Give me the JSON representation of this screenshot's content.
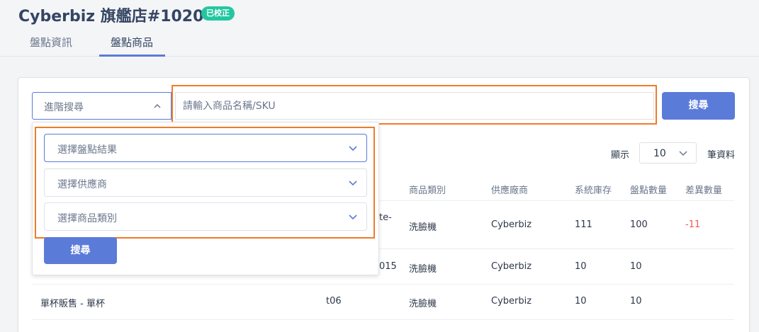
{
  "header": {
    "title": "Cyberbiz 旗艦店#1020",
    "badge": "已校正",
    "tabs": [
      {
        "label": "盤點資訊"
      },
      {
        "label": "盤點商品"
      }
    ]
  },
  "search": {
    "advanced_label": "進階搜尋",
    "placeholder": "請輸入商品名稱/SKU",
    "button_label": "搜尋"
  },
  "filters": {
    "result_placeholder": "選擇盤點結果",
    "supplier_placeholder": "選擇供應商",
    "category_placeholder": "選擇商品類別",
    "button_label": "搜尋"
  },
  "pagination": {
    "show_label": "顯示",
    "per_page": "10",
    "records_label": "筆資料"
  },
  "table": {
    "columns": {
      "category": "商品類別",
      "supplier": "供應廠商",
      "system_stock": "系統庫存",
      "counted_qty": "盤點數量",
      "diff_qty": "差異數量"
    },
    "rows": [
      {
        "name": "",
        "sku_fragment": "te-",
        "category": "洗臉機",
        "supplier": "Cyberbiz",
        "system_stock": "111",
        "counted_qty": "100",
        "diff_qty": "-11"
      },
      {
        "name": "",
        "sku_fragment": "015",
        "category": "洗臉機",
        "supplier": "Cyberbiz",
        "system_stock": "10",
        "counted_qty": "10",
        "diff_qty": ""
      },
      {
        "name": "單杯販售 - 單杯",
        "sku_fragment": "t06",
        "category": "洗臉機",
        "supplier": "Cyberbiz",
        "system_stock": "10",
        "counted_qty": "10",
        "diff_qty": ""
      }
    ]
  },
  "colors": {
    "accent": "#5b7bd9",
    "badge": "#22c7a0",
    "highlight": "#f07b2a",
    "negative": "#f25757"
  }
}
